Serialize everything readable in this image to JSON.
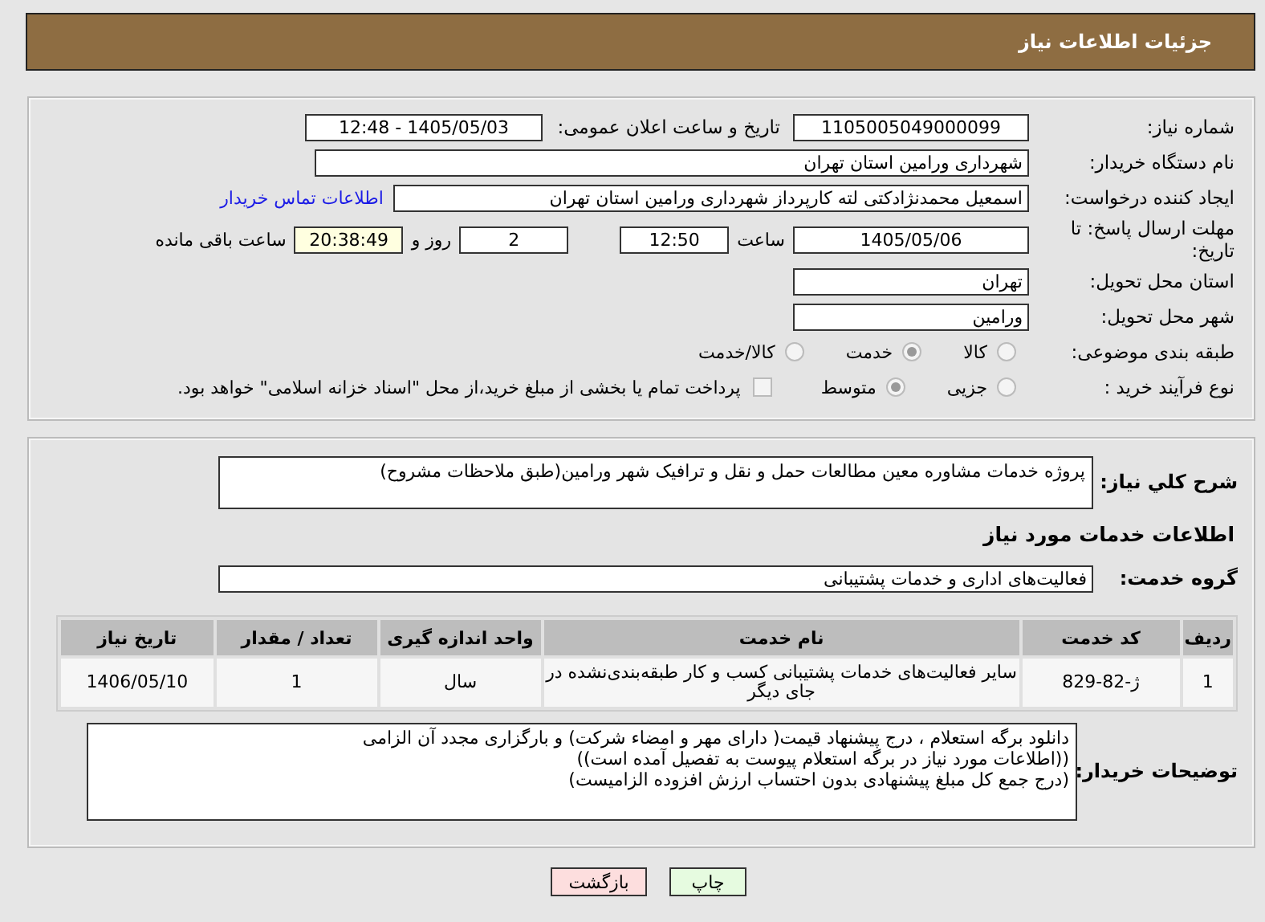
{
  "header": {
    "title": "جزئیات اطلاعات نیاز"
  },
  "need_number": {
    "label": "شماره نیاز:",
    "value": "1105005049000099"
  },
  "announce": {
    "label": "تاریخ و ساعت اعلان عمومی:",
    "value": "1405/05/03 - 12:48"
  },
  "buyer_org": {
    "label": "نام دستگاه خریدار:",
    "value": "شهرداری ورامین استان تهران"
  },
  "requester": {
    "label": "ایجاد کننده درخواست:",
    "value": "اسمعیل محمدنژادکتی لته کارپرداز شهرداری ورامین استان تهران",
    "link": "اطلاعات تماس خریدار"
  },
  "deadline": {
    "label": "مهلت ارسال پاسخ: تا تاریخ:",
    "date": "1405/05/06",
    "time_label": "ساعت",
    "time": "12:50",
    "days": "2",
    "days_label": "روز و",
    "remaining": "20:38:49",
    "remaining_label": "ساعت باقی مانده"
  },
  "province": {
    "label": "استان محل تحویل:",
    "value": "تهران"
  },
  "city": {
    "label": "شهر محل تحویل:",
    "value": "ورامین"
  },
  "category": {
    "label": "طبقه بندی موضوعی:",
    "options": [
      {
        "label": "کالا",
        "selected": false
      },
      {
        "label": "خدمت",
        "selected": true
      },
      {
        "label": "کالا/خدمت",
        "selected": false
      }
    ]
  },
  "purchase_type": {
    "label": "نوع فرآیند خرید :",
    "options": [
      {
        "label": "جزیی",
        "selected": false
      },
      {
        "label": "متوسط",
        "selected": true
      }
    ],
    "payment_note": {
      "checked": false,
      "text": "پرداخت تمام یا بخشی از مبلغ خرید،از محل \"اسناد خزانه اسلامی\" خواهد بود."
    }
  },
  "description": {
    "label": "شرح کلي نیاز:",
    "value": "پروژه خدمات مشاوره معین مطالعات حمل و نقل و ترافیک شهر ورامین(طبق ملاحظات مشروح)"
  },
  "services_title": "اطلاعات خدمات مورد نیاز",
  "service_group": {
    "label": "گروه خدمت:",
    "value": "فعالیت‌های اداری و خدمات پشتیبانی"
  },
  "table": {
    "columns": [
      "ردیف",
      "کد خدمت",
      "نام خدمت",
      "واحد اندازه گیری",
      "تعداد / مقدار",
      "تاریخ نیاز"
    ],
    "rows": [
      [
        "1",
        "ژ-82-829",
        "سایر فعالیت‌های خدمات پشتیبانی کسب و کار طبقه‌بندی‌نشده در جای دیگر",
        "سال",
        "1",
        "1406/05/10"
      ]
    ]
  },
  "buyer_notes": {
    "label": "توضیحات خریدار:",
    "lines": [
      "دانلود برگه استعلام ، درج پیشنهاد قیمت( دارای مهر و امضاء شرکت) و بارگزاری مجدد آن الزامی",
      "((اطلاعات مورد نیاز در برگه استعلام پیوست به تفصیل آمده است))",
      "(درج  جمع کل مبلغ پیشنهادی بدون احتساب ارزش افزوده الزامیست)"
    ]
  },
  "buttons": [
    {
      "label": "چاپ",
      "kind": "print"
    },
    {
      "label": "بازگشت",
      "kind": "back"
    }
  ]
}
